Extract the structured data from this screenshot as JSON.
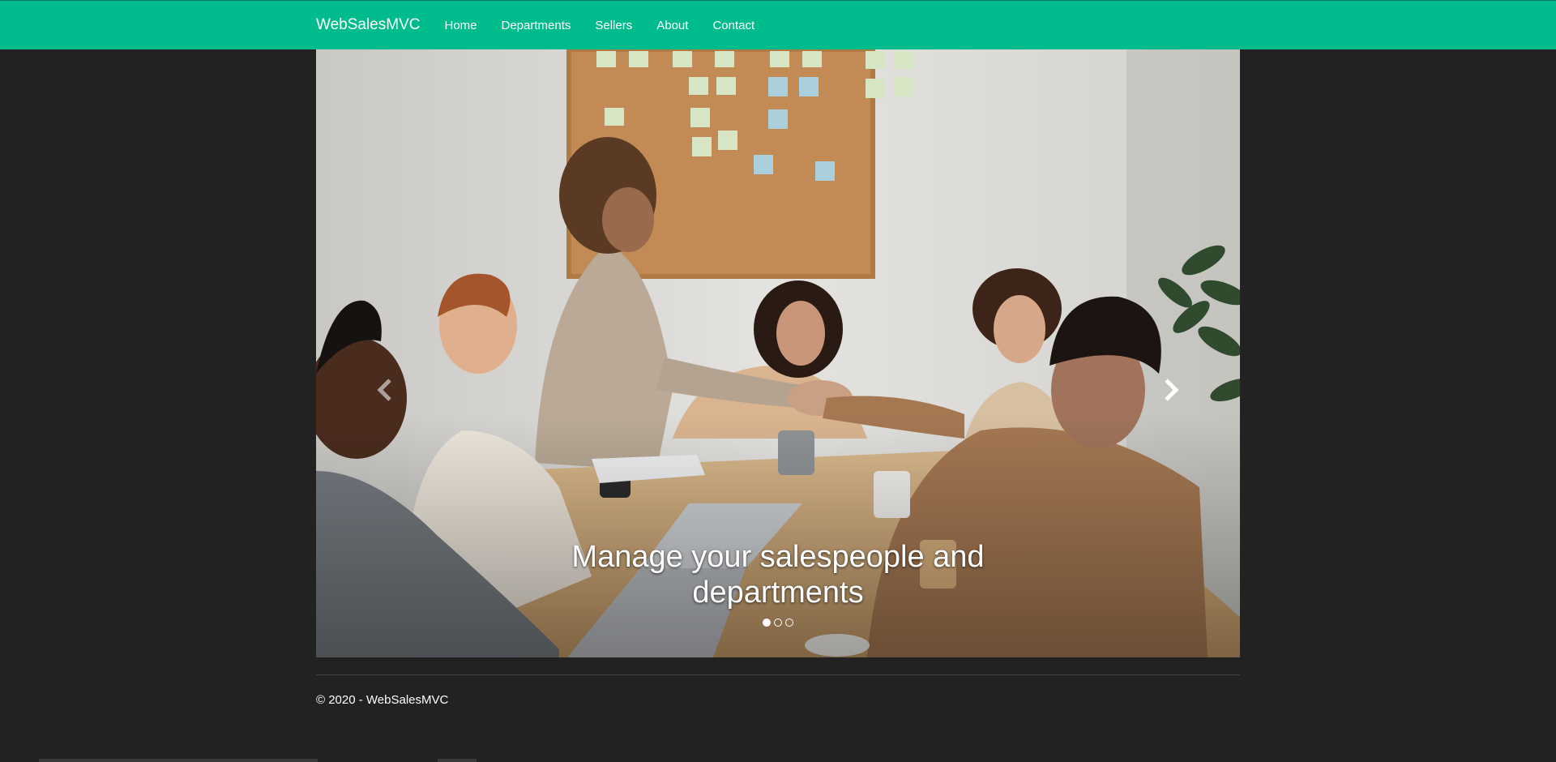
{
  "navbar": {
    "brand": "WebSalesMVC",
    "links": [
      "Home",
      "Departments",
      "Sellers",
      "About",
      "Contact"
    ],
    "bg_color": "#00bc8c"
  },
  "carousel": {
    "caption": "Manage your salespeople and departments",
    "slide_count": 3,
    "active_slide": 1,
    "prev_icon": "chevron-left-icon",
    "next_icon": "chevron-right-icon"
  },
  "footer": {
    "copyright": "© 2020 - WebSalesMVC"
  },
  "colors": {
    "page_bg": "#222222",
    "accent": "#00bc8c"
  }
}
